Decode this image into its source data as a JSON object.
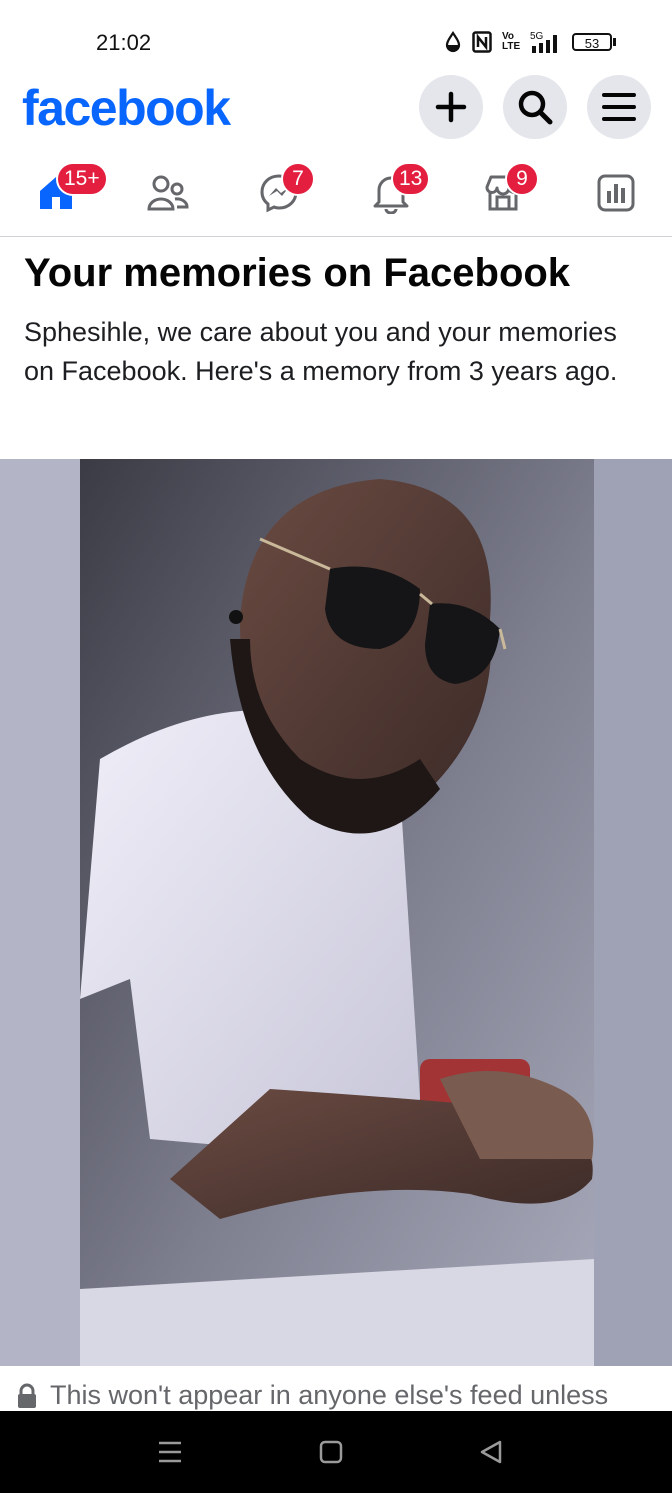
{
  "status_bar": {
    "time": "21:02",
    "network_top": "5G",
    "volte_label": "Vo LTE",
    "battery_level": "53"
  },
  "header": {
    "logo": "facebook",
    "buttons": [
      "create-post",
      "search",
      "menu"
    ]
  },
  "nav_tabs": [
    {
      "name": "home",
      "badge": "15+",
      "active": true
    },
    {
      "name": "friends",
      "badge": ""
    },
    {
      "name": "messenger",
      "badge": "7"
    },
    {
      "name": "notifications",
      "badge": "13"
    },
    {
      "name": "marketplace",
      "badge": "9"
    },
    {
      "name": "professional-dashboard",
      "badge": ""
    }
  ],
  "memories": {
    "title": "Your memories on Facebook",
    "message": "Sphesihle, we care about you and your memories on Facebook. Here's a memory from 3 years ago."
  },
  "privacy_note": "This won't appear in anyone else's feed unless",
  "colors": {
    "brand": "#0866ff",
    "badge": "#e41e3f",
    "button_bg": "#e4e6eb",
    "text_secondary": "#65676b"
  }
}
